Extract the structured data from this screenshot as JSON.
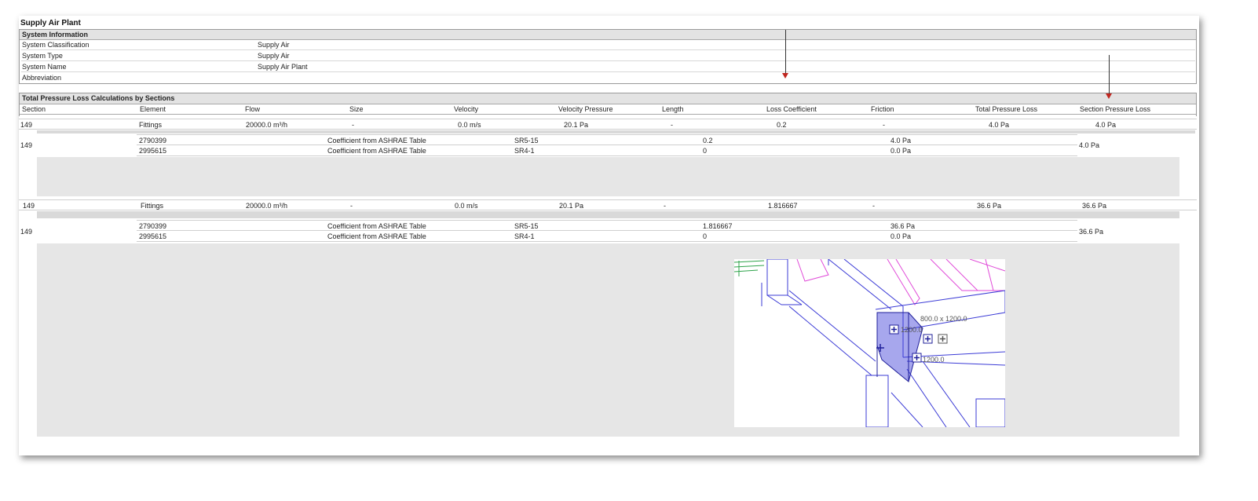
{
  "report": {
    "title": "Supply Air Plant",
    "system_info": {
      "heading": "System Information",
      "rows": [
        {
          "label": "System Classification",
          "value": "Supply Air"
        },
        {
          "label": "System Type",
          "value": "Supply Air"
        },
        {
          "label": "System Name",
          "value": "Supply Air Plant"
        },
        {
          "label": "Abbreviation",
          "value": ""
        }
      ]
    },
    "sections": {
      "heading": "Total Pressure Loss Calculations by Sections",
      "columns": [
        "Section",
        "Element",
        "Flow",
        "Size",
        "Velocity",
        "Velocity Pressure",
        "Length",
        "Loss Coefficient",
        "Friction",
        "Total Pressure Loss",
        "Section Pressure Loss"
      ],
      "groups": [
        {
          "summary": {
            "section": "149",
            "element": "Fittings",
            "flow": "20000.0 m³/h",
            "size": "-",
            "velocity": "0.0 m/s",
            "velocity_pressure": "20.1 Pa",
            "length": "-",
            "loss_coefficient": "0.2",
            "friction": "-",
            "total_pressure_loss": "4.0 Pa",
            "section_pressure_loss": "4.0 Pa"
          },
          "detail": {
            "section": "149",
            "section_pressure_loss": "4.0 Pa",
            "rows": [
              {
                "element": "2790399",
                "method": "Coefficient from ASHRAE Table",
                "code": "SR5-15",
                "coefficient": "0.2",
                "loss": "4.0 Pa"
              },
              {
                "element": "2995615",
                "method": "Coefficient from ASHRAE Table",
                "code": "SR4-1",
                "coefficient": "0",
                "loss": "0.0 Pa"
              }
            ]
          }
        },
        {
          "summary": {
            "section": "149",
            "element": "Fittings",
            "flow": "20000.0 m³/h",
            "size": "-",
            "velocity": "0.0 m/s",
            "velocity_pressure": "20.1 Pa",
            "length": "-",
            "loss_coefficient": "1.816667",
            "friction": "-",
            "total_pressure_loss": "36.6 Pa",
            "section_pressure_loss": "36.6 Pa"
          },
          "detail": {
            "section": "149",
            "section_pressure_loss": "36.6 Pa",
            "rows": [
              {
                "element": "2790399",
                "method": "Coefficient from ASHRAE Table",
                "code": "SR5-15",
                "coefficient": "1.816667",
                "loss": "36.6 Pa"
              },
              {
                "element": "2995615",
                "method": "Coefficient from ASHRAE Table",
                "code": "SR4-1",
                "coefficient": "0",
                "loss": "0.0 Pa"
              }
            ]
          }
        }
      ]
    },
    "view_labels": {
      "size_a": "800.0 x 1200.0",
      "size_b": "1200.0",
      "size_c": "1200.0"
    },
    "colors": {
      "arrow": "#c0261f",
      "duct_blue": "#3b3bd6",
      "magenta": "#e04ad8",
      "green": "#2ea34a"
    }
  }
}
